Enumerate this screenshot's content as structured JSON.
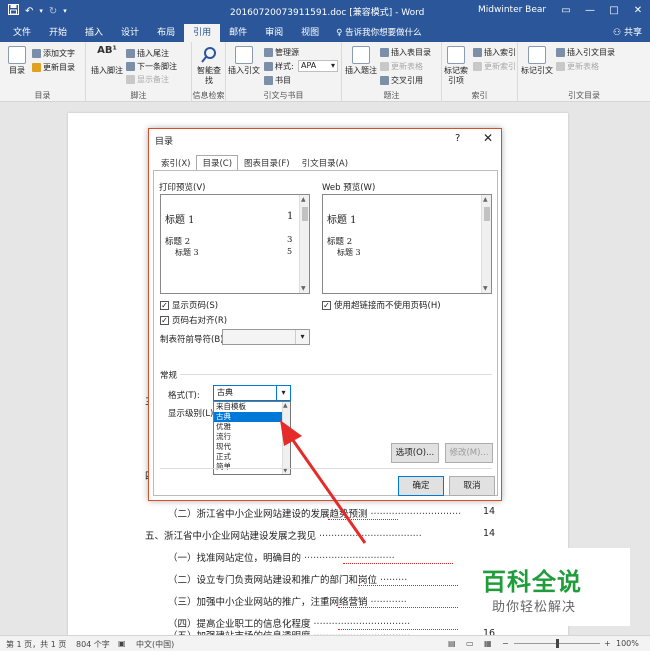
{
  "titlebar": {
    "save_icon": "save-icon",
    "undo_icon": "undo-icon",
    "redo_icon": "redo-icon",
    "customize_icon": "customize-qat-icon",
    "title": "20160720073911591.doc [兼容模式] - Word",
    "user": "Midwinter Bear",
    "minimize": "—",
    "maximize": "□",
    "close": "✕"
  },
  "tabs": {
    "items": [
      "文件",
      "开始",
      "插入",
      "设计",
      "布局",
      "引用",
      "邮件",
      "审阅",
      "视图"
    ],
    "active": "引用",
    "tell_me": "♀ 告诉我你想要做什么",
    "share": "共享"
  },
  "ribbon": {
    "toc": {
      "label": "目录",
      "group": "目录",
      "add_text": "添加文字",
      "update_table": "更新目录"
    },
    "footnotes": {
      "insert": "插入脚注",
      "insert_endnote": "插入尾注",
      "next": "下一条脚注",
      "show": "显示备注",
      "group": "脚注"
    },
    "research": {
      "smart_lookup": "智能查找",
      "group": "信息检索"
    },
    "citations": {
      "insert": "插入引文",
      "manage": "管理源",
      "style_label": "样式:",
      "style_value": "APA",
      "bibliography": "书目",
      "group": "引文与书目"
    },
    "captions": {
      "insert": "插入题注",
      "insert_tof": "插入表目录",
      "update_table": "更新表格",
      "cross_ref": "交叉引用",
      "group": "题注"
    },
    "index": {
      "mark": "标记索引项",
      "insert": "插入索引",
      "update": "更新索引",
      "group": "索引"
    },
    "toa": {
      "mark": "标记引文",
      "insert": "插入引文目录",
      "update": "更新表格",
      "group": "引文目录"
    }
  },
  "document": {
    "lines": [
      {
        "text": "（二）浙江省中小企业网站建设的发展趋势预测",
        "page": "14"
      },
      {
        "text": "五、浙江省中小企业网站建设发展之我见",
        "page": "14"
      },
      {
        "text": "（一）找准网站定位，明确目的",
        "page": ""
      },
      {
        "text": "（二）设立专门负责网站建设和推广的部门和岗位",
        "page": ""
      },
      {
        "text": "（三）加强中小企业网站的推广，注重网络营销",
        "page": ""
      },
      {
        "text": "（四）提高企业职工的信息化程度",
        "page": ""
      },
      {
        "text": "（五）加强建站市场的信息透明度",
        "page": "16"
      }
    ],
    "left_fragments": [
      "三",
      "四"
    ]
  },
  "dialog": {
    "title": "目录",
    "help": "?",
    "close": "✕",
    "tabs": [
      "索引(X)",
      "目录(C)",
      "图表目录(F)",
      "引文目录(A)"
    ],
    "active_tab": "目录(C)",
    "print_preview_label": "打印预览(V)",
    "web_preview_label": "Web 预览(W)",
    "print_preview": {
      "h1": "标题 1",
      "h1_page": "1",
      "h2": "标题 2",
      "h2_page": "3",
      "h3": "标题 3",
      "h3_page": "5"
    },
    "web_preview": {
      "h1": "标题 1",
      "h2": "标题 2",
      "h3": "标题 3"
    },
    "show_page_numbers": "显示页码(S)",
    "right_align": "页码右对齐(R)",
    "tab_leader_label": "制表符前导符(B):",
    "tab_leader_value": "",
    "use_hyperlinks": "使用超链接而不使用页码(H)",
    "general_label": "常规",
    "format_label": "格式(T):",
    "format_value": "古典",
    "show_levels_label": "显示级别(L):",
    "format_options": [
      "来自模板",
      "古典",
      "优雅",
      "流行",
      "现代",
      "正式",
      "简单"
    ],
    "format_selected": "古典",
    "options_button": "选项(O)...",
    "modify_button": "修改(M)...",
    "ok_button": "确定",
    "cancel_button": "取消"
  },
  "statusbar": {
    "page": "第 1 页，共 1 页",
    "words": "804 个字",
    "lang": "中文(中国)",
    "zoom": "100%"
  },
  "watermark": {
    "main": "百科全说",
    "sub": "助你轻松解决"
  },
  "colors": {
    "word_blue": "#2b579a",
    "dialog_border": "#d54f2a",
    "selection": "#0078d7",
    "arrow": "#e52a2a",
    "watermark_green": "#1f9d3a"
  }
}
